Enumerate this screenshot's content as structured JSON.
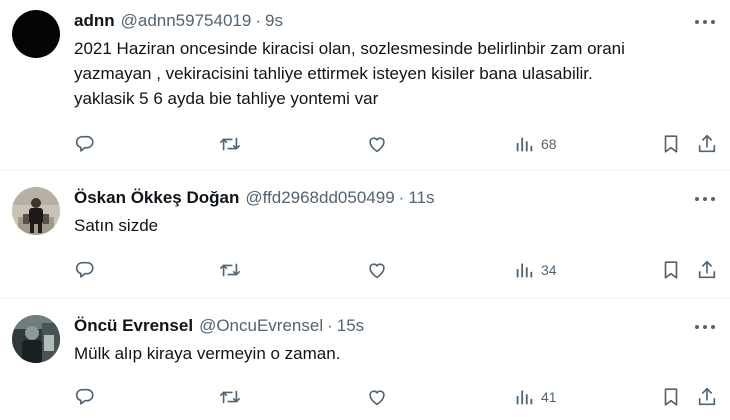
{
  "tweets": [
    {
      "name": "adnn",
      "handle": "@adnn59754019",
      "dot": "·",
      "time": "9s",
      "text": "2021 Haziran oncesinde kiracisi olan, sozlesmesinde belirlinbir zam orani\nyazmayan , vekiracisini tahliye ettirmek isteyen kisiler bana ulasabilir.\nyaklasik 5 6 ayda bie tahliye yontemi var",
      "views": "68",
      "avatar": "black-avatar"
    },
    {
      "name": "Öskan Ökkeş Doğan",
      "handle": "@ffd2968dd050499",
      "dot": "·",
      "time": "11s",
      "text": "Satın sizde",
      "views": "34",
      "avatar": "person-photo-avatar"
    },
    {
      "name": "Öncü Evrensel",
      "handle": "@OncuEvrensel",
      "dot": "·",
      "time": "15s",
      "text": "Mülk alıp kiraya vermeyin o zaman.",
      "views": "41",
      "avatar": "person-photo-avatar"
    }
  ],
  "icons": {
    "reply": "reply-icon",
    "repost": "repost-icon",
    "like": "like-icon",
    "views": "views-icon",
    "bookmark": "bookmark-icon",
    "share": "share-icon",
    "more": "more-icon"
  },
  "colors": {
    "text": "#0f1419",
    "secondary": "#536471",
    "divider": "#eff3f4"
  }
}
